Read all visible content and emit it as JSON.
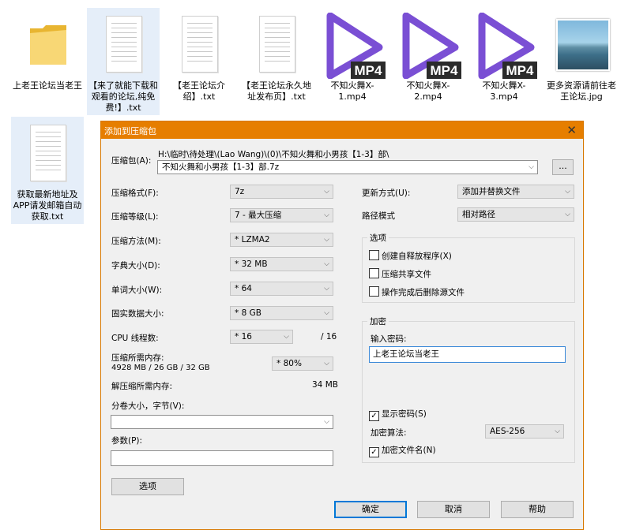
{
  "files": [
    {
      "label": "上老王论坛当老王",
      "kind": "folder"
    },
    {
      "label": "【来了就能下载和观看的论坛,纯免费!】.txt",
      "kind": "text"
    },
    {
      "label": "【老王论坛介绍】.txt",
      "kind": "text"
    },
    {
      "label": "【老王论坛永久地址发布页】.txt",
      "kind": "text"
    },
    {
      "label": "不知火舞X-1.mp4",
      "kind": "mp4",
      "badge": "MP4"
    },
    {
      "label": "不知火舞X-2.mp4",
      "kind": "mp4",
      "badge": "MP4"
    },
    {
      "label": "不知火舞X-3.mp4",
      "kind": "mp4",
      "badge": "MP4"
    },
    {
      "label": "更多资源请前往老王论坛.jpg",
      "kind": "image"
    },
    {
      "label": "获取最新地址及APP请发邮箱自动获取.txt",
      "kind": "text"
    }
  ],
  "dialog": {
    "title": "添加到压缩包",
    "close": "✕",
    "archive_label": "压缩包(A):",
    "archive_path": "H:\\临时\\待处理\\(Lao Wang)\\(0)\\不知火舞和小男孩【1-3】部\\",
    "archive_name": "不知火舞和小男孩【1-3】部.7z",
    "browse": "...",
    "left": {
      "format_label": "压缩格式(F):",
      "format": "7z",
      "level_label": "压缩等级(L):",
      "level": "7 - 最大压缩",
      "method_label": "压缩方法(M):",
      "method": "* LZMA2",
      "dict_label": "字典大小(D):",
      "dict": "* 32 MB",
      "word_label": "单词大小(W):",
      "word": "* 64",
      "solid_label": "固实数据大小:",
      "solid": "* 8 GB",
      "threads_label": "CPU 线程数:",
      "threads": "* 16",
      "threads_total": "/ 16",
      "mem_label": "压缩所需内存:",
      "mem_value": "4928 MB / 26 GB / 32 GB",
      "mem_pct": "* 80%",
      "decomp_label": "解压缩所需内存:",
      "decomp_value": "34 MB",
      "split_label": "分卷大小，字节(V):",
      "split": "",
      "params_label": "参数(P):",
      "params": ""
    },
    "right": {
      "update_label": "更新方式(U):",
      "update": "添加并替换文件",
      "path_label": "路径模式",
      "path": "相对路径",
      "options_title": "选项",
      "opt_sfx": "创建自释放程序(X)",
      "opt_shared": "压缩共享文件",
      "opt_delete": "操作完成后删除源文件",
      "enc_title": "加密",
      "pwd_label": "输入密码:",
      "pwd": "上老王论坛当老王",
      "show_pwd": "显示密码(S)",
      "algo_label": "加密算法:",
      "algo": "AES-256",
      "enc_names": "加密文件名(N)"
    },
    "options_btn": "选项",
    "ok": "确定",
    "cancel": "取消",
    "help": "帮助",
    "checkmark": "✓",
    "dropdown_arrow": "⌵"
  }
}
